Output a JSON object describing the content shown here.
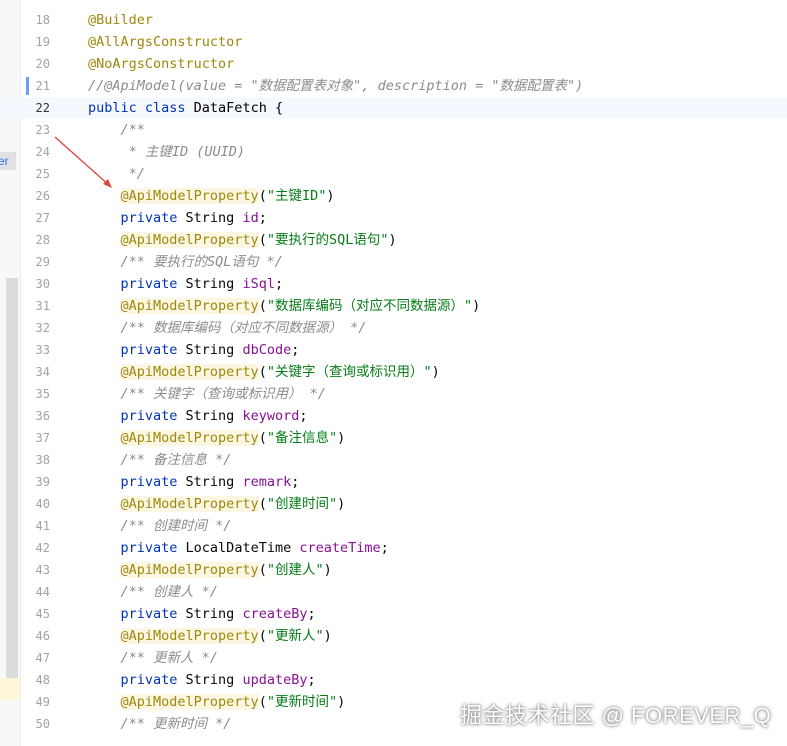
{
  "sidebar": {
    "tab_label": "er"
  },
  "editor": {
    "current_line": "22",
    "lines": [
      {
        "n": "18",
        "tokens": [
          {
            "t": "@Builder",
            "c": "anno"
          }
        ]
      },
      {
        "n": "19",
        "tokens": [
          {
            "t": "@AllArgsConstructor",
            "c": "anno"
          }
        ]
      },
      {
        "n": "20",
        "tokens": [
          {
            "t": "@NoArgsConstructor",
            "c": "anno"
          }
        ]
      },
      {
        "n": "21",
        "tokens": [
          {
            "t": "//@ApiModel(value = \"数据配置表对象\", description = \"数据配置表\")",
            "c": "cmt"
          }
        ]
      },
      {
        "n": "22",
        "tokens": [
          {
            "t": "public class ",
            "c": "kw"
          },
          {
            "t": "DataFetch",
            "c": "cls"
          },
          {
            "t": " {",
            "c": ""
          }
        ]
      },
      {
        "n": "23",
        "tokens": [
          {
            "t": "    /**",
            "c": "doc"
          }
        ]
      },
      {
        "n": "24",
        "tokens": [
          {
            "t": "     * 主键ID (UUID)",
            "c": "doc"
          }
        ]
      },
      {
        "n": "25",
        "tokens": [
          {
            "t": "     */",
            "c": "doc"
          }
        ]
      },
      {
        "n": "26",
        "tokens": [
          {
            "t": "    ",
            "c": ""
          },
          {
            "t": "@ApiModelProperty",
            "c": "anno"
          },
          {
            "t": "(",
            "c": ""
          },
          {
            "t": "\"主键ID\"",
            "c": "str"
          },
          {
            "t": ")",
            "c": ""
          }
        ]
      },
      {
        "n": "27",
        "tokens": [
          {
            "t": "    private ",
            "c": "kw"
          },
          {
            "t": "String ",
            "c": ""
          },
          {
            "t": "id",
            "c": "field"
          },
          {
            "t": ";",
            "c": ""
          }
        ]
      },
      {
        "n": "28",
        "tokens": [
          {
            "t": "    ",
            "c": ""
          },
          {
            "t": "@ApiModelProperty",
            "c": "anno"
          },
          {
            "t": "(",
            "c": ""
          },
          {
            "t": "\"要执行的SQL语句\"",
            "c": "str"
          },
          {
            "t": ")",
            "c": ""
          }
        ]
      },
      {
        "n": "29",
        "tokens": [
          {
            "t": "    /** 要执行的SQL语句 */",
            "c": "doc"
          }
        ]
      },
      {
        "n": "30",
        "tokens": [
          {
            "t": "    private ",
            "c": "kw"
          },
          {
            "t": "String ",
            "c": ""
          },
          {
            "t": "iSql",
            "c": "field"
          },
          {
            "t": ";",
            "c": ""
          }
        ]
      },
      {
        "n": "31",
        "tokens": [
          {
            "t": "    ",
            "c": ""
          },
          {
            "t": "@ApiModelProperty",
            "c": "anno"
          },
          {
            "t": "(",
            "c": ""
          },
          {
            "t": "\"数据库编码（对应不同数据源）\"",
            "c": "str"
          },
          {
            "t": ")",
            "c": ""
          }
        ]
      },
      {
        "n": "32",
        "tokens": [
          {
            "t": "    /** 数据库编码（对应不同数据源） */",
            "c": "doc"
          }
        ]
      },
      {
        "n": "33",
        "tokens": [
          {
            "t": "    private ",
            "c": "kw"
          },
          {
            "t": "String ",
            "c": ""
          },
          {
            "t": "dbCode",
            "c": "field"
          },
          {
            "t": ";",
            "c": ""
          }
        ]
      },
      {
        "n": "34",
        "tokens": [
          {
            "t": "    ",
            "c": ""
          },
          {
            "t": "@ApiModelProperty",
            "c": "anno"
          },
          {
            "t": "(",
            "c": ""
          },
          {
            "t": "\"关键字（查询或标识用）\"",
            "c": "str"
          },
          {
            "t": ")",
            "c": ""
          }
        ]
      },
      {
        "n": "35",
        "tokens": [
          {
            "t": "    /** 关键字（查询或标识用） */",
            "c": "doc"
          }
        ]
      },
      {
        "n": "36",
        "tokens": [
          {
            "t": "    private ",
            "c": "kw"
          },
          {
            "t": "String ",
            "c": ""
          },
          {
            "t": "keyword",
            "c": "field"
          },
          {
            "t": ";",
            "c": ""
          }
        ]
      },
      {
        "n": "37",
        "tokens": [
          {
            "t": "    ",
            "c": ""
          },
          {
            "t": "@ApiModelProperty",
            "c": "anno"
          },
          {
            "t": "(",
            "c": ""
          },
          {
            "t": "\"备注信息\"",
            "c": "str"
          },
          {
            "t": ")",
            "c": ""
          }
        ]
      },
      {
        "n": "38",
        "tokens": [
          {
            "t": "    /** 备注信息 */",
            "c": "doc"
          }
        ]
      },
      {
        "n": "39",
        "tokens": [
          {
            "t": "    private ",
            "c": "kw"
          },
          {
            "t": "String ",
            "c": ""
          },
          {
            "t": "remark",
            "c": "field"
          },
          {
            "t": ";",
            "c": ""
          }
        ]
      },
      {
        "n": "40",
        "tokens": [
          {
            "t": "    ",
            "c": ""
          },
          {
            "t": "@ApiModelProperty",
            "c": "anno"
          },
          {
            "t": "(",
            "c": ""
          },
          {
            "t": "\"创建时间\"",
            "c": "str"
          },
          {
            "t": ")",
            "c": ""
          }
        ]
      },
      {
        "n": "41",
        "tokens": [
          {
            "t": "    /** 创建时间 */",
            "c": "doc"
          }
        ]
      },
      {
        "n": "42",
        "tokens": [
          {
            "t": "    private ",
            "c": "kw"
          },
          {
            "t": "LocalDateTime ",
            "c": ""
          },
          {
            "t": "createTime",
            "c": "field"
          },
          {
            "t": ";",
            "c": ""
          }
        ]
      },
      {
        "n": "43",
        "tokens": [
          {
            "t": "    ",
            "c": ""
          },
          {
            "t": "@ApiModelProperty",
            "c": "anno"
          },
          {
            "t": "(",
            "c": ""
          },
          {
            "t": "\"创建人\"",
            "c": "str"
          },
          {
            "t": ")",
            "c": ""
          }
        ]
      },
      {
        "n": "44",
        "tokens": [
          {
            "t": "    /** 创建人 */",
            "c": "doc"
          }
        ]
      },
      {
        "n": "45",
        "tokens": [
          {
            "t": "    private ",
            "c": "kw"
          },
          {
            "t": "String ",
            "c": ""
          },
          {
            "t": "createBy",
            "c": "field"
          },
          {
            "t": ";",
            "c": ""
          }
        ]
      },
      {
        "n": "46",
        "tokens": [
          {
            "t": "    ",
            "c": ""
          },
          {
            "t": "@ApiModelProperty",
            "c": "anno"
          },
          {
            "t": "(",
            "c": ""
          },
          {
            "t": "\"更新人\"",
            "c": "str"
          },
          {
            "t": ")",
            "c": ""
          }
        ]
      },
      {
        "n": "47",
        "tokens": [
          {
            "t": "    /** 更新人 */",
            "c": "doc"
          }
        ]
      },
      {
        "n": "48",
        "tokens": [
          {
            "t": "    private ",
            "c": "kw"
          },
          {
            "t": "String ",
            "c": ""
          },
          {
            "t": "updateBy",
            "c": "field"
          },
          {
            "t": ";",
            "c": ""
          }
        ]
      },
      {
        "n": "49",
        "tokens": [
          {
            "t": "    ",
            "c": ""
          },
          {
            "t": "@ApiModelProperty",
            "c": "anno"
          },
          {
            "t": "(",
            "c": ""
          },
          {
            "t": "\"更新时间\"",
            "c": "str"
          },
          {
            "t": ")",
            "c": ""
          }
        ]
      },
      {
        "n": "50",
        "tokens": [
          {
            "t": "    /** 更新时间 */",
            "c": "doc"
          }
        ]
      }
    ]
  },
  "watermark": {
    "text": "掘金技术社区 @ FOREVER_Q"
  },
  "colors": {
    "keyword": "#0033b3",
    "annotation": "#9e880d",
    "string": "#067d17",
    "field": "#871094",
    "comment": "#8c8c8c",
    "arrow": "#d9463a"
  }
}
